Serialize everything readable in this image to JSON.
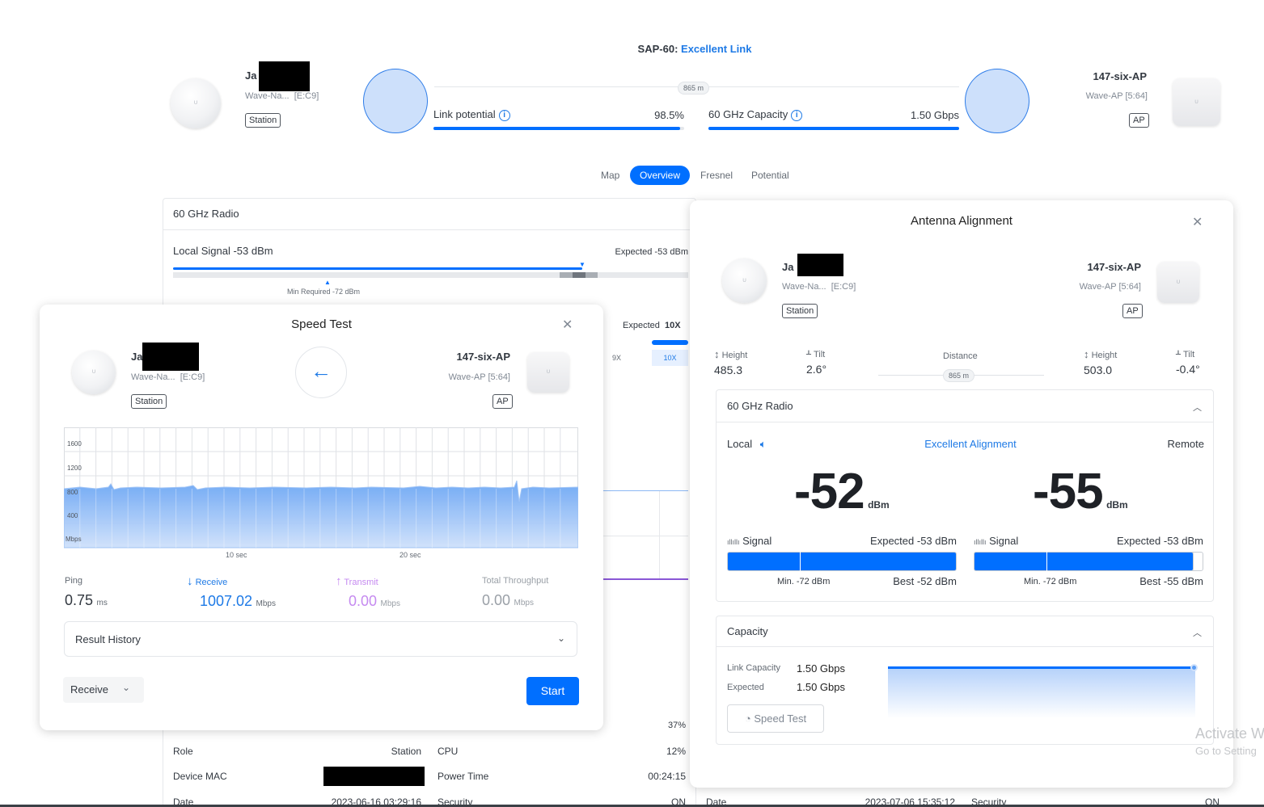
{
  "header": {
    "link_prefix": "SAP-60:",
    "link_status": "Excellent Link",
    "distance": "865 m",
    "link_potential_label": "Link potential",
    "link_potential_value": "98.5%",
    "link_potential_fraction": 0.985,
    "capacity_label": "60 GHz Capacity",
    "capacity_value": "1.50 Gbps",
    "capacity_fraction": 1.0
  },
  "local_device": {
    "name_prefix": "Ja",
    "model": "Wave-Na...",
    "mac_suffix": "[E:C9]",
    "role": "Station"
  },
  "remote_device": {
    "name": "147-six-AP",
    "model": "Wave-AP [5:64]",
    "role": "AP"
  },
  "tabs": [
    "Map",
    "Overview",
    "Fresnel",
    "Potential"
  ],
  "active_tab": "Overview",
  "radio_panel": {
    "title": "60 GHz Radio",
    "local_signal": "Local Signal -53 dBm",
    "expected": "Expected -53 dBm",
    "min_required": "Min Required -72 dBm",
    "expected_mod_label": "Expected",
    "expected_mod": "10X",
    "mod_options": [
      "9X",
      "10X"
    ]
  },
  "bottom_table": {
    "rows": [
      {
        "label": "",
        "value": "",
        "label2": "",
        "value2": "37%"
      },
      {
        "label": "Role",
        "value": "Station",
        "label2": "CPU",
        "value2": "12%"
      },
      {
        "label": "Device MAC",
        "value": "",
        "label2": "Power Time",
        "value2": "00:24:15"
      },
      {
        "label": "Date",
        "value": "2023-06-16 03:29:16",
        "label2": "Security",
        "value2": "ON"
      }
    ],
    "right_row": {
      "label": "Date",
      "value": "2023-07-06 15:35:12",
      "label2": "Security",
      "value2": "ON"
    }
  },
  "speed_test": {
    "title": "Speed Test",
    "y_ticks": [
      "1600",
      "1200",
      "800",
      "400",
      "Mbps"
    ],
    "x_ticks": [
      "10 sec",
      "20 sec"
    ],
    "ping_label": "Ping",
    "ping_value": "0.75",
    "ping_unit": "ms",
    "receive_label": "Receive",
    "receive_value": "1007.02",
    "receive_unit": "Mbps",
    "transmit_label": "Transmit",
    "transmit_value": "0.00",
    "transmit_unit": "Mbps",
    "total_label": "Total Throughput",
    "total_value": "0.00",
    "total_unit": "Mbps",
    "history_label": "Result History",
    "direction_select": "Receive",
    "start_label": "Start",
    "colors": {
      "accent": "#006fff",
      "transmit": "#c58af0"
    }
  },
  "alignment": {
    "title": "Antenna Alignment",
    "local_height_label": "Height",
    "local_height": "485.3",
    "local_tilt_label": "Tilt",
    "local_tilt": "2.6°",
    "distance_label": "Distance",
    "distance": "865 m",
    "remote_height_label": "Height",
    "remote_height": "503.0",
    "remote_tilt_label": "Tilt",
    "remote_tilt": "-0.4°",
    "radio_section": "60 GHz Radio",
    "local_label": "Local",
    "alignment_status": "Excellent Alignment",
    "remote_label": "Remote",
    "local_dbm": "-52",
    "remote_dbm": "-55",
    "dbm_unit": "dBm",
    "signal_label": "Signal",
    "local_expected": "Expected -53 dBm",
    "remote_expected": "Expected -53 dBm",
    "local_min": "Min. -72 dBm",
    "remote_min": "Min. -72 dBm",
    "local_best": "Best -52 dBm",
    "remote_best": "Best -55 dBm",
    "capacity_section": "Capacity",
    "link_capacity_label": "Link Capacity",
    "link_capacity": "1.50 Gbps",
    "expected_label": "Expected",
    "expected_capacity": "1.50 Gbps",
    "speed_test_button": "Speed Test"
  },
  "watermark": {
    "line1": "Activate W",
    "line2": "Go to Setting"
  }
}
